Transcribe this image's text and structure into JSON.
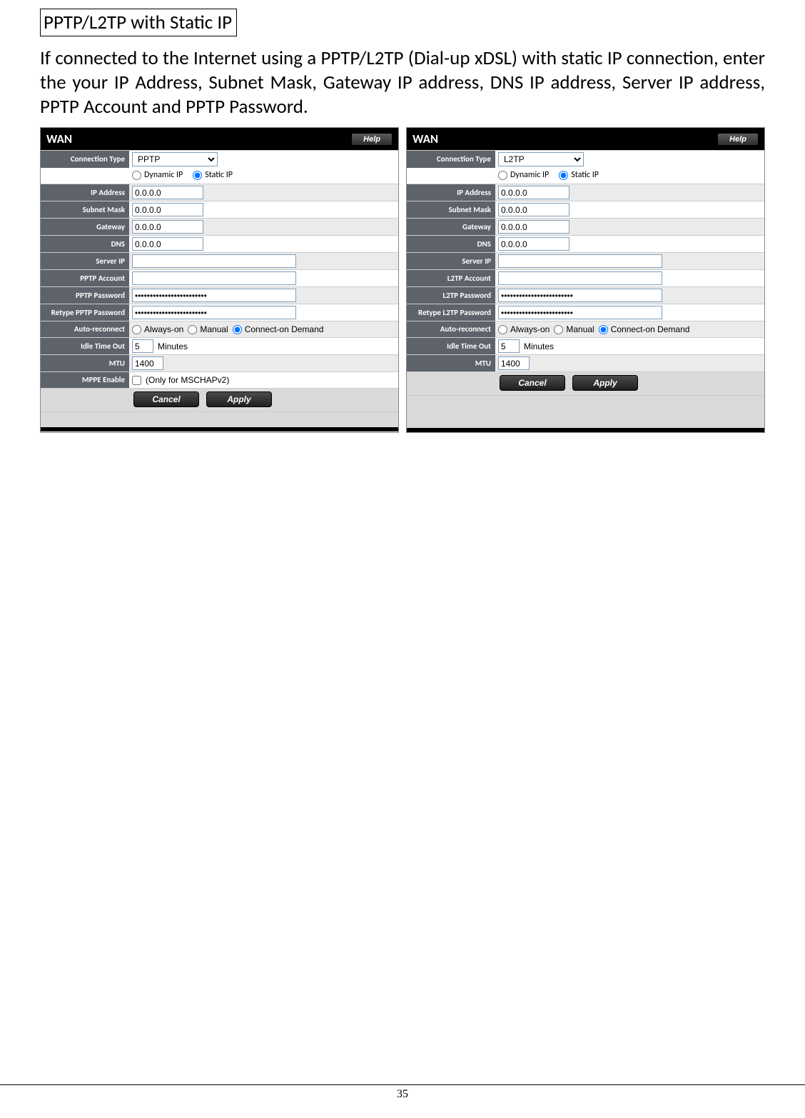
{
  "page": {
    "section_title": "PPTP/L2TP with Static IP",
    "paragraph": "If connected to the Internet using a PPTP/L2TP (Dial-up xDSL) with static IP connection, enter the your IP Address, Subnet Mask, Gateway IP address, DNS IP address, Server IP address, PPTP Account and PPTP Password.",
    "page_number": "35"
  },
  "common": {
    "help": "Help",
    "cancel": "Cancel",
    "apply": "Apply",
    "dynamic_ip": "Dynamic IP",
    "static_ip": "Static IP",
    "always_on": "Always-on",
    "manual": "Manual",
    "connect_on_demand": "Connect-on Demand",
    "minutes": "Minutes",
    "mschap_note": "(Only for MSCHAPv2)"
  },
  "left": {
    "title": "WAN",
    "connection_type": "PPTP",
    "labels": {
      "connection_type": "Connection Type",
      "ip_address": "IP Address",
      "subnet_mask": "Subnet Mask",
      "gateway": "Gateway",
      "dns": "DNS",
      "server_ip": "Server IP",
      "account": "PPTP Account",
      "password": "PPTP Password",
      "retype_password": "Retype PPTP Password",
      "auto_reconnect": "Auto-reconnect",
      "idle_timeout": "Idle Time Out",
      "mtu": "MTU",
      "mppe": "MPPE Enable"
    },
    "values": {
      "ip_address": "0.0.0.0",
      "subnet_mask": "0.0.0.0",
      "gateway": "0.0.0.0",
      "dns": "0.0.0.0",
      "server_ip": "",
      "account": "",
      "password": "••••••••••••••••••••••••",
      "retype_password": "••••••••••••••••••••••••",
      "idle_timeout": "5",
      "mtu": "1400"
    }
  },
  "right": {
    "title": "WAN",
    "connection_type": "L2TP",
    "labels": {
      "connection_type": "Connection Type",
      "ip_address": "IP Address",
      "subnet_mask": "Subnet Mask",
      "gateway": "Gateway",
      "dns": "DNS",
      "server_ip": "Server IP",
      "account": "L2TP Account",
      "password": "L2TP Password",
      "retype_password": "Retype L2TP Password",
      "auto_reconnect": "Auto-reconnect",
      "idle_timeout": "Idle Time Out",
      "mtu": "MTU"
    },
    "values": {
      "ip_address": "0.0.0.0",
      "subnet_mask": "0.0.0.0",
      "gateway": "0.0.0.0",
      "dns": "0.0.0.0",
      "server_ip": "",
      "account": "",
      "password": "••••••••••••••••••••••••",
      "retype_password": "••••••••••••••••••••••••",
      "idle_timeout": "5",
      "mtu": "1400"
    }
  }
}
